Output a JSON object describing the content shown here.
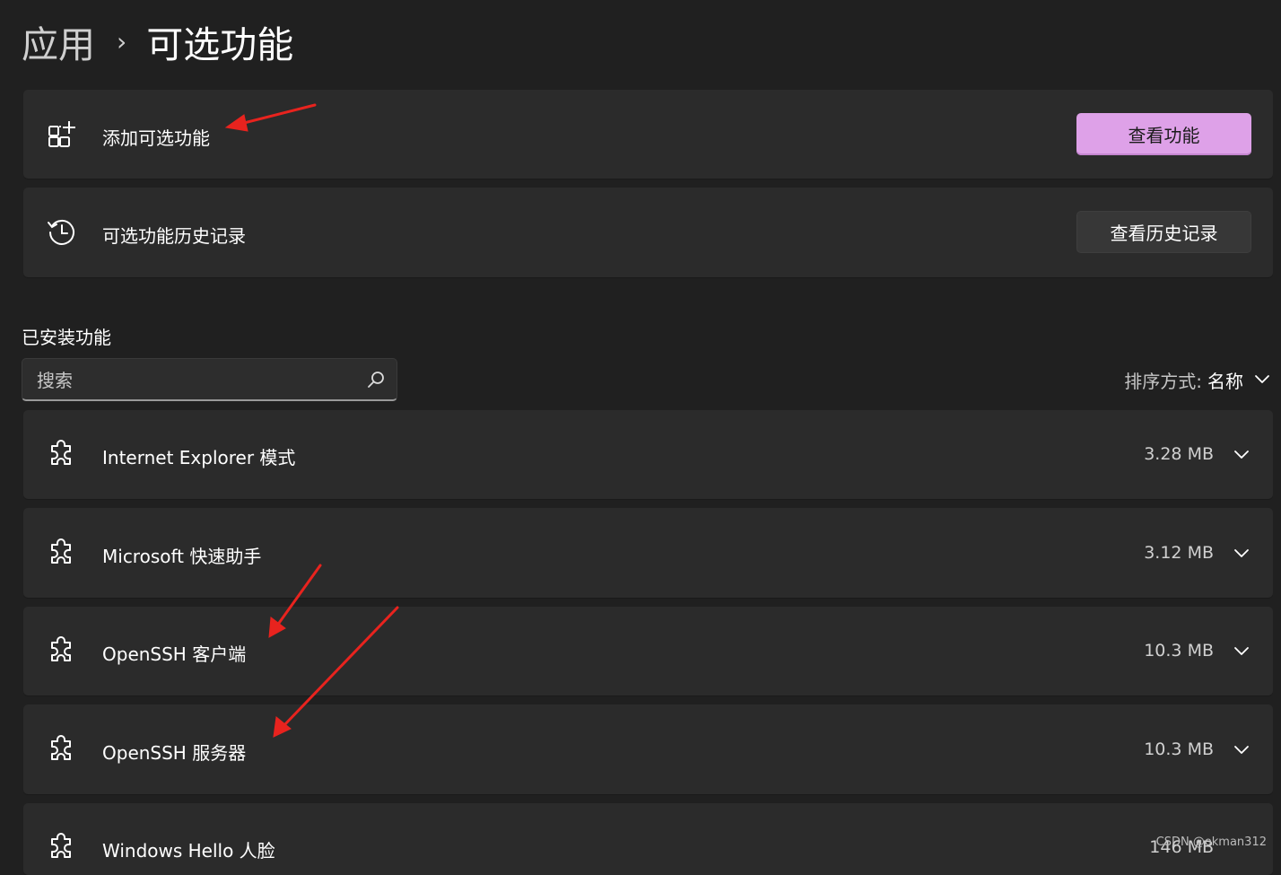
{
  "breadcrumb": {
    "parent": "应用",
    "separator": "›",
    "current": "可选功能"
  },
  "add_card": {
    "label": "添加可选功能",
    "button": "查看功能"
  },
  "history_card": {
    "label": "可选功能历史记录",
    "button": "查看历史记录"
  },
  "installed": {
    "title": "已安装功能",
    "search_placeholder": "搜索",
    "sort_label": "排序方式:",
    "sort_value": "名称",
    "items": [
      {
        "name": "Internet Explorer 模式",
        "size": "3.28 MB"
      },
      {
        "name": "Microsoft 快速助手",
        "size": "3.12 MB"
      },
      {
        "name": "OpenSSH 客户端",
        "size": "10.3 MB"
      },
      {
        "name": "OpenSSH 服务器",
        "size": "10.3 MB"
      },
      {
        "name": "Windows Hello 人脸",
        "size": "146 MB"
      }
    ]
  },
  "watermark": "CSDN @okman312",
  "colors": {
    "background": "#202020",
    "card": "#2b2b2b",
    "accent": "#dea1e8",
    "annotation": "#e8231e"
  },
  "icons": {
    "add_card": "apps-add-icon",
    "history_card": "history-icon",
    "feature": "puzzle-icon",
    "search": "search-icon",
    "expand": "chevron-down-icon"
  }
}
